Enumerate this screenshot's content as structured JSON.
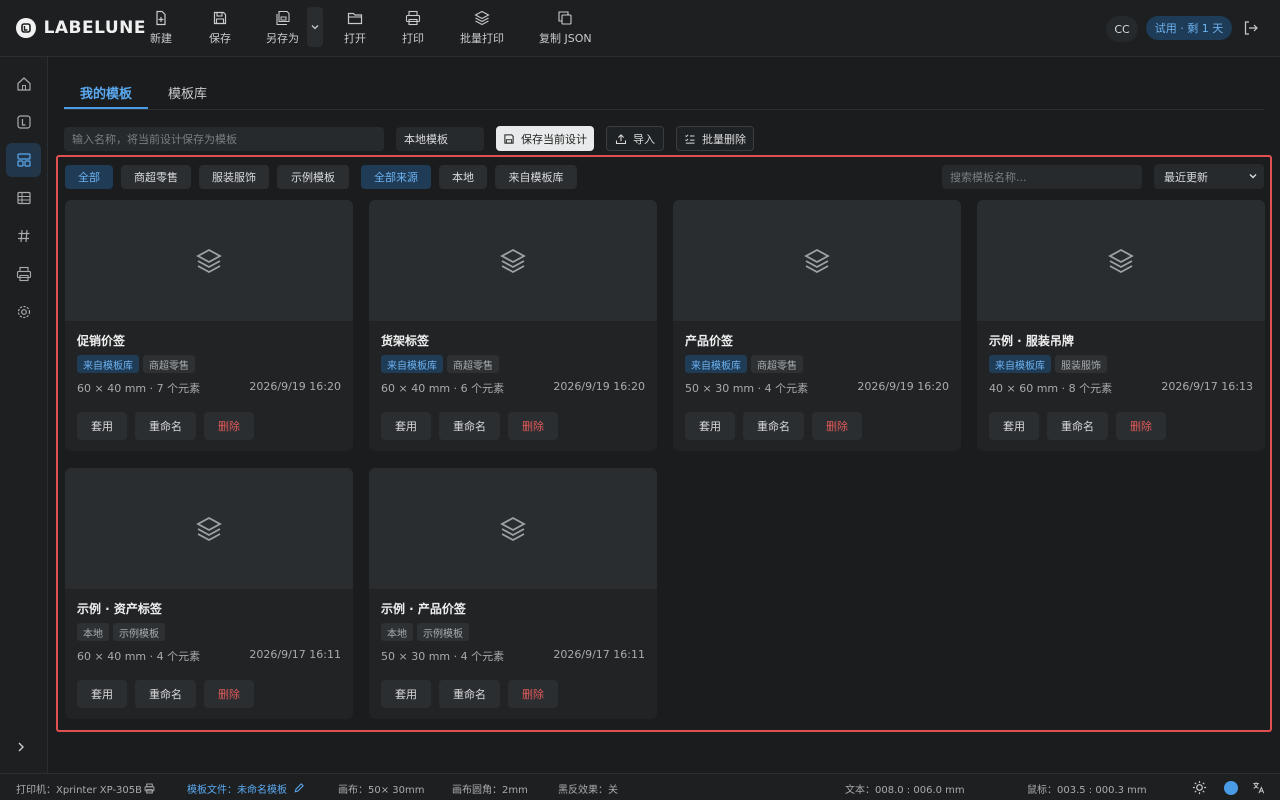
{
  "app": {
    "name": "LABELUNE"
  },
  "toolbar": {
    "new_label": "新建",
    "save_label": "保存",
    "saveas_label": "另存为",
    "open_label": "打开",
    "print_label": "打印",
    "batch_print_label": "批量打印",
    "copy_json_label": "复制 JSON"
  },
  "user": {
    "initials": "CC",
    "trial": "试用 · 剩 1 天"
  },
  "tabs": [
    {
      "label": "我的模板"
    },
    {
      "label": "模板库"
    }
  ],
  "actions": {
    "name_placeholder": "输入名称，将当前设计保存为模板",
    "location": "本地模板",
    "save_current": "保存当前设计",
    "import": "导入",
    "batch_delete": "批量删除"
  },
  "filters": {
    "categories": [
      "全部",
      "商超零售",
      "服装服饰",
      "示例模板"
    ],
    "sources": [
      "全部来源",
      "本地",
      "来自模板库"
    ],
    "search_placeholder": "搜索模板名称...",
    "sort": "最近更新"
  },
  "card_actions": {
    "apply": "套用",
    "rename": "重命名",
    "delete": "删除"
  },
  "templates": [
    {
      "title": "促销价签",
      "source": "来自模板库",
      "category": "商超零售",
      "meta": "60 × 40 mm · 7 个元素",
      "date": "2026/9/19 16:20"
    },
    {
      "title": "货架标签",
      "source": "来自模板库",
      "category": "商超零售",
      "meta": "60 × 40 mm · 6 个元素",
      "date": "2026/9/19 16:20"
    },
    {
      "title": "产品价签",
      "source": "来自模板库",
      "category": "商超零售",
      "meta": "50 × 30 mm · 4 个元素",
      "date": "2026/9/19 16:20"
    },
    {
      "title": "示例 · 服装吊牌",
      "source": "来自模板库",
      "category": "服装服饰",
      "meta": "40 × 60 mm · 8 个元素",
      "date": "2026/9/17 16:13"
    },
    {
      "title": "示例 · 资产标签",
      "source": "本地",
      "category": "示例模板",
      "meta": "60 × 40 mm · 4 个元素",
      "date": "2026/9/17 16:11"
    },
    {
      "title": "示例 · 产品价签",
      "source": "本地",
      "category": "示例模板",
      "meta": "50 × 30 mm · 4 个元素",
      "date": "2026/9/17 16:11"
    }
  ],
  "status": {
    "printer": "打印机：Xprinter XP-305B",
    "file_prefix": "模板文件：",
    "file_name": "未命名模板",
    "canvas": "画布：50× 30mm",
    "corner": "画布圆角：2mm",
    "invert": "黑反效果：关",
    "text_pos": "文本：008.0 : 006.0 mm",
    "mouse_pos": "鼠标：003.5 : 000.3 mm"
  },
  "colors": {
    "accent": "#4a9be6",
    "danger": "#e05a5a",
    "highlight_border": "#e05050"
  }
}
